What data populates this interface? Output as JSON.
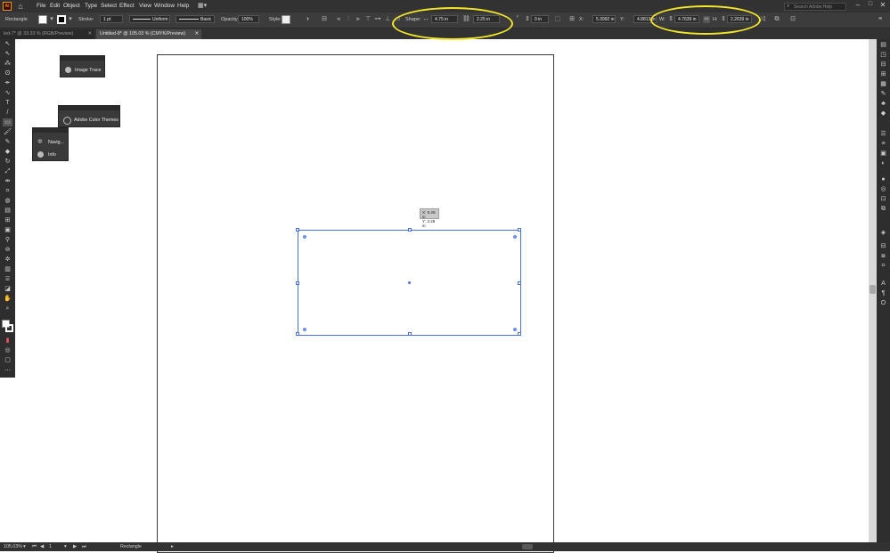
{
  "app": {
    "logo": "Ai",
    "menu": [
      "File",
      "Edit",
      "Object",
      "Type",
      "Select",
      "Effect",
      "View",
      "Window",
      "Help"
    ],
    "search_placeholder": "Search Adobe Help"
  },
  "controlbar": {
    "selection_type": "Rectangle",
    "stroke_label": "Stroke:",
    "stroke_weight": "1 pt",
    "stroke_profile": "Uniform",
    "brush": "Basic",
    "opacity_label": "Opacity:",
    "opacity_value": "100%",
    "style_label": "Style:",
    "shape_label": "Shape:",
    "shape_width": "4.75 in",
    "shape_height": "2.25 in",
    "corner_radius": "0 in",
    "x_label": "X:",
    "x_value": "5.3992 in",
    "y_label": "Y:",
    "y_value": "4.8813 in",
    "w_label": "W:",
    "w_value": "4.7639 in",
    "h_label": "H:",
    "h_value": "2.2639 in"
  },
  "tabs": [
    {
      "label": "led-7* @ 33.33 % (RGB/Preview)",
      "active": false
    },
    {
      "label": "Untitled-8* @ 105.03 % (CMYK/Preview)",
      "active": true
    }
  ],
  "panels": {
    "image_trace": "Image Trace",
    "color_themes": "Adobe Color Themes",
    "navigator": "Navig...",
    "info": "Info"
  },
  "selection_tooltip": {
    "x": "X: 5.26 in",
    "y": "Y: 3.28 in"
  },
  "statusbar": {
    "zoom": "105.03%",
    "artboard_number": "1",
    "tool_name": "Rectangle"
  },
  "colors": {
    "highlight": "#f2e52a",
    "selection": "#4a6fd8",
    "ui_dark": "#323232"
  }
}
